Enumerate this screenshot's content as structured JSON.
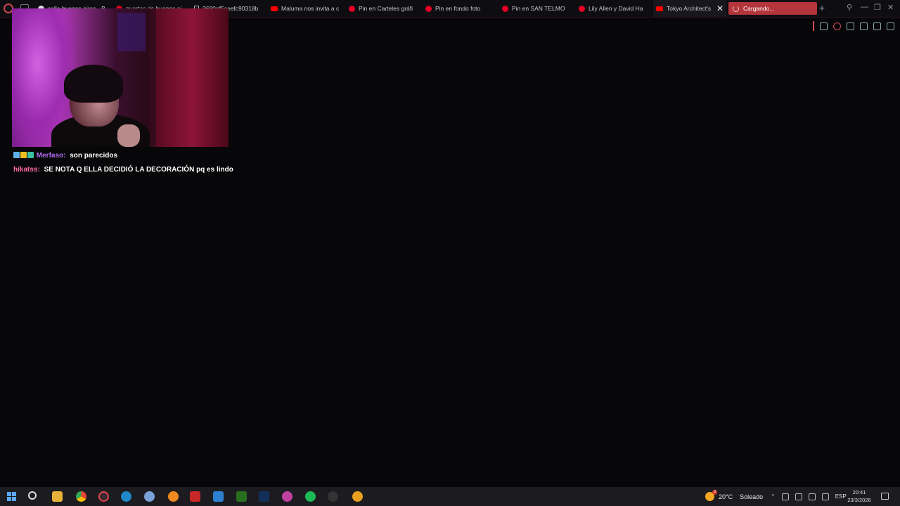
{
  "browser": {
    "tabs": [
      {
        "label": "calle buenos aires - B",
        "favicon": "google-icon"
      },
      {
        "label": "puertas de buenos ai",
        "favicon": "pinterest-icon"
      },
      {
        "label": "3680ef5ceefc90318b",
        "favicon": "document-icon"
      },
      {
        "label": "Maluma nos invita a c",
        "favicon": "youtube-icon"
      },
      {
        "label": "Pin en Carteles gráfi",
        "favicon": "pinterest-icon"
      },
      {
        "label": "Pin en fondo foto",
        "favicon": "pinterest-icon"
      },
      {
        "label": "Pin en SAN TELMO",
        "favicon": "pinterest-icon"
      },
      {
        "label": "Lily Allen y David Ha",
        "favicon": "pinterest-icon"
      },
      {
        "label": "Tokyo Architect's",
        "favicon": "youtube-icon"
      }
    ],
    "loading_tab": {
      "label": "Cargando..."
    },
    "new_tab_label": "+",
    "close_label": "✕"
  },
  "chat": {
    "messages": [
      {
        "user": "Merfaso:",
        "user_color": "#b46bf0",
        "text": "son parecidos",
        "badges": [
          "sword-badge-icon",
          "crown-badge-icon",
          "subscriber-badge-icon"
        ]
      },
      {
        "user": "hikatss:",
        "user_color": "#ff6fa0",
        "text": "SE NOTA Q ELLA DECIDIÓ LA DECORACIÓN pq es lindo",
        "badges": []
      }
    ]
  },
  "taskbar": {
    "weather": {
      "temp": "20°C",
      "condition": "Soleado",
      "badge": "3"
    },
    "language": "ESP",
    "time": "20:41",
    "date": "23/3/2026"
  },
  "colors": {
    "accent_red": "#b4353c",
    "page_background": "#070709"
  }
}
